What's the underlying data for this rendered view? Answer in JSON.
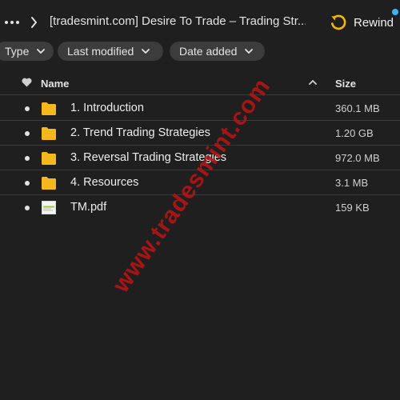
{
  "topbar": {
    "breadcrumb": "[tradesmint.com] Desire To Trade – Trading Str...",
    "rewind_label": "Rewind"
  },
  "filters": [
    {
      "label": "Type"
    },
    {
      "label": "Last modified"
    },
    {
      "label": "Date added"
    }
  ],
  "table": {
    "columns": {
      "name": "Name",
      "size": "Size"
    },
    "sort": "ascending",
    "rows": [
      {
        "name": "1. Introduction",
        "size": "360.1 MB",
        "kind": "folder-icon"
      },
      {
        "name": "2. Trend Trading Strategies",
        "size": "1.20 GB",
        "kind": "folder-icon"
      },
      {
        "name": "3. Reversal Trading Strategies",
        "size": "972.0 MB",
        "kind": "folder-icon"
      },
      {
        "name": "4. Resources",
        "size": "3.1 MB",
        "kind": "folder-icon"
      },
      {
        "name": "TM.pdf",
        "size": "159 KB",
        "kind": "pdf-file-icon"
      }
    ]
  },
  "watermark": "www.tradesmint.com",
  "colors": {
    "background": "#1f1f1f",
    "chip": "#3c3c3c",
    "folder": "#f5b81c",
    "accent_dot": "#38b6f5",
    "rewind_icon": "#f5b800",
    "watermark": "#be1414"
  }
}
